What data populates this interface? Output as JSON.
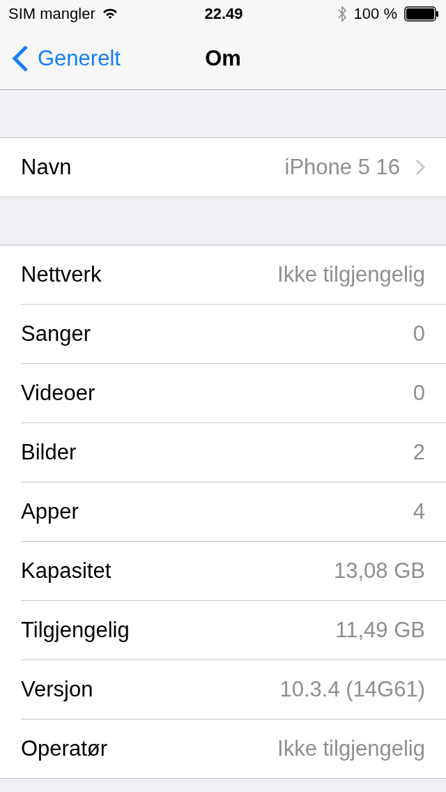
{
  "status_bar": {
    "carrier": "SIM mangler",
    "time": "22.49",
    "battery": "100 %"
  },
  "nav": {
    "back": "Generelt",
    "title": "Om"
  },
  "groups": [
    {
      "rows": [
        {
          "label": "Navn",
          "value": "iPhone 5 16",
          "disclosure": true
        }
      ]
    },
    {
      "rows": [
        {
          "label": "Nettverk",
          "value": "Ikke tilgjengelig",
          "disclosure": false
        },
        {
          "label": "Sanger",
          "value": "0",
          "disclosure": false
        },
        {
          "label": "Videoer",
          "value": "0",
          "disclosure": false
        },
        {
          "label": "Bilder",
          "value": "2",
          "disclosure": false
        },
        {
          "label": "Apper",
          "value": "4",
          "disclosure": false
        },
        {
          "label": "Kapasitet",
          "value": "13,08 GB",
          "disclosure": false
        },
        {
          "label": "Tilgjengelig",
          "value": "11,49 GB",
          "disclosure": false
        },
        {
          "label": "Versjon",
          "value": "10.3.4 (14G61)",
          "disclosure": false
        },
        {
          "label": "Operatør",
          "value": "Ikke tilgjengelig",
          "disclosure": false
        }
      ]
    }
  ]
}
